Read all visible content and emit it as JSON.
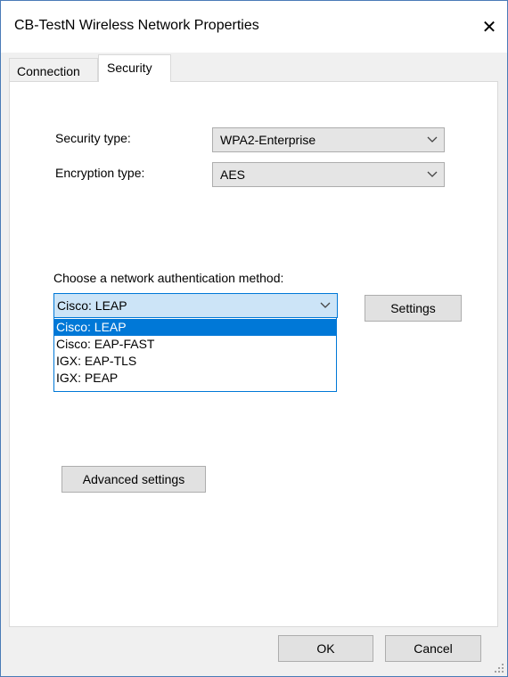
{
  "window": {
    "title": "CB-TestN Wireless Network Properties",
    "close_glyph": "✕"
  },
  "tabs": [
    {
      "label": "Connection",
      "active": false
    },
    {
      "label": "Security",
      "active": true
    }
  ],
  "security": {
    "security_type_label": "Security type:",
    "security_type_value": "WPA2-Enterprise",
    "encryption_type_label": "Encryption type:",
    "encryption_type_value": "AES",
    "auth_method_label": "Choose a network authentication method:",
    "auth_method_value": "Cisco: LEAP",
    "settings_button": "Settings",
    "auth_options": [
      {
        "label": "Cisco: LEAP",
        "selected": true
      },
      {
        "label": "Cisco: EAP-FAST",
        "selected": false
      },
      {
        "label": "IGX: EAP-TLS",
        "selected": false
      },
      {
        "label": "IGX: PEAP",
        "selected": false
      }
    ],
    "advanced_button": "Advanced settings"
  },
  "footer": {
    "ok_label": "OK",
    "cancel_label": "Cancel"
  },
  "colors": {
    "accent": "#0078d7",
    "selection_bg": "#cce4f7",
    "button_bg": "#e1e1e1"
  }
}
